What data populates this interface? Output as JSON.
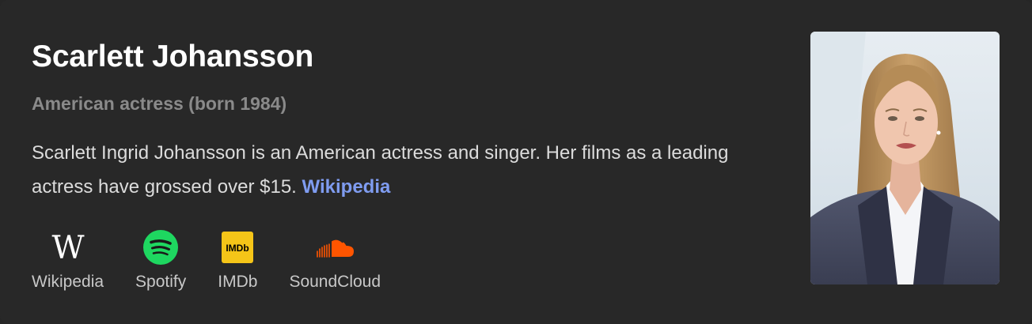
{
  "entity": {
    "name": "Scarlett Johansson",
    "subtitle": "American actress (born 1984)",
    "description": "Scarlett Ingrid Johansson is an American actress and singer. Her films as a leading actress have grossed over $15.",
    "source_link": "Wikipedia"
  },
  "links": [
    {
      "label": "Wikipedia",
      "icon": "wikipedia-icon"
    },
    {
      "label": "Spotify",
      "icon": "spotify-icon",
      "color": "#1ed760"
    },
    {
      "label": "IMDb",
      "icon": "imdb-icon",
      "color": "#f5c518"
    },
    {
      "label": "SoundCloud",
      "icon": "soundcloud-icon",
      "color": "#ff5500"
    }
  ],
  "colors": {
    "background": "#282828",
    "title": "#ffffff",
    "subtitle": "#8a8a8a",
    "body_text": "#dcdcdc",
    "link": "#7f9cf0"
  }
}
